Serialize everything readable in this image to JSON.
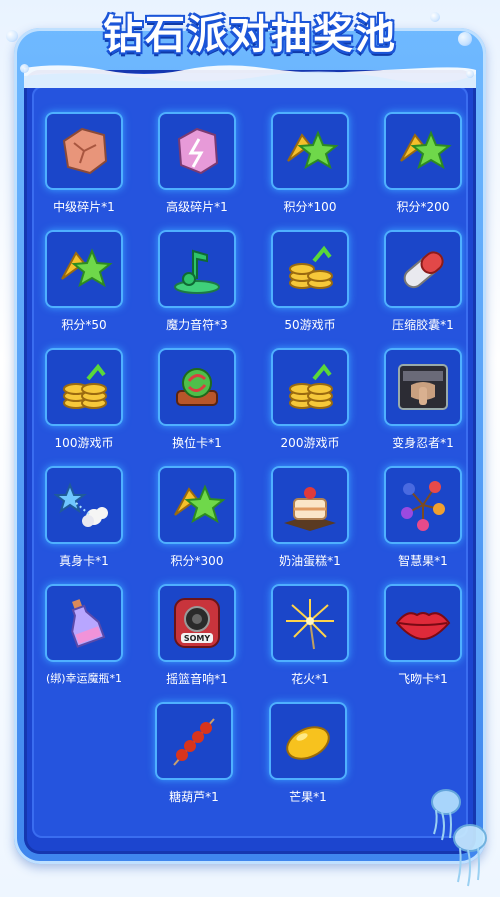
{
  "title": "钻石派对抽奖池",
  "items": [
    {
      "label": "中级碎片*1",
      "icon": "mid-fragment-icon"
    },
    {
      "label": "高级碎片*1",
      "icon": "high-fragment-icon"
    },
    {
      "label": "积分*100",
      "icon": "points-star-icon"
    },
    {
      "label": "积分*200",
      "icon": "points-star-icon"
    },
    {
      "label": "积分*50",
      "icon": "points-star-icon"
    },
    {
      "label": "魔力音符*3",
      "icon": "magic-note-icon"
    },
    {
      "label": "50游戏币",
      "icon": "coin-stack-icon"
    },
    {
      "label": "压缩胶囊*1",
      "icon": "capsule-icon"
    },
    {
      "label": "100游戏币",
      "icon": "coin-stack-icon"
    },
    {
      "label": "换位卡*1",
      "icon": "swap-card-icon"
    },
    {
      "label": "200游戏币",
      "icon": "coin-stack-icon"
    },
    {
      "label": "变身忍者*1",
      "icon": "ninja-card-icon"
    },
    {
      "label": "真身卡*1",
      "icon": "true-form-card-icon"
    },
    {
      "label": "积分*300",
      "icon": "points-star-icon"
    },
    {
      "label": "奶油蛋糕*1",
      "icon": "cream-cake-icon"
    },
    {
      "label": "智慧果*1",
      "icon": "wisdom-fruit-icon"
    },
    {
      "label": "(绑)幸运魔瓶*1",
      "icon": "lucky-bottle-icon"
    },
    {
      "label": "摇篮音响*1",
      "icon": "speaker-icon"
    },
    {
      "label": "花火*1",
      "icon": "firework-icon"
    },
    {
      "label": "飞吻卡*1",
      "icon": "kiss-lips-icon"
    },
    {
      "label": "糖葫芦*1",
      "icon": "candied-haws-icon"
    },
    {
      "label": "芒果*1",
      "icon": "mango-icon"
    }
  ],
  "speaker_brand": "SOMY",
  "colors": {
    "panel": "#2554de",
    "slot": "#1b46c9",
    "glow": "#4fb0ff",
    "frame": "#5aa6fb"
  }
}
